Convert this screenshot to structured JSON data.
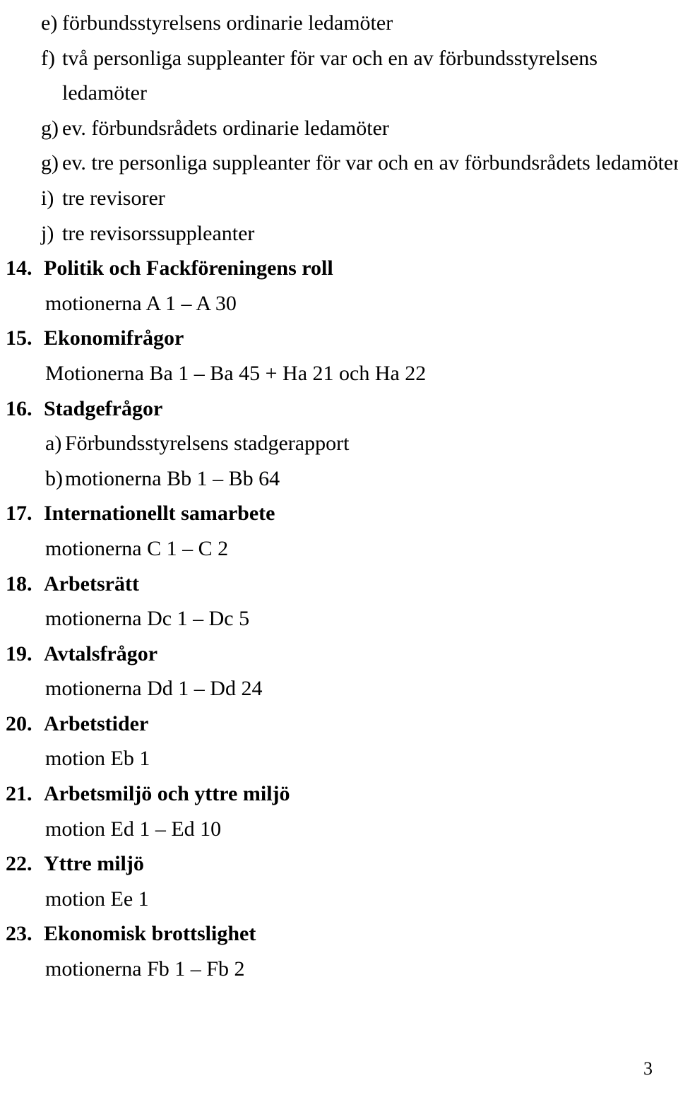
{
  "document": {
    "page_number": "3",
    "lines": [
      {
        "kind": "letter-item",
        "marker": "e)",
        "text": "förbundsstyrelsens ordinarie ledamöter"
      },
      {
        "kind": "letter-item",
        "marker": "f)",
        "text": "två personliga suppleanter för var och en av förbundsstyrelsens"
      },
      {
        "kind": "continuation",
        "marker": "",
        "text": "ledamöter"
      },
      {
        "kind": "letter-item",
        "marker": "g)",
        "text": "ev. förbundsrådets ordinarie ledamöter"
      },
      {
        "kind": "letter-item",
        "marker": "g)",
        "text": "ev. tre personliga suppleanter för var och en av förbundsrådets ledamöter"
      },
      {
        "kind": "letter-item",
        "marker": "i)",
        "text": "tre revisorer"
      },
      {
        "kind": "letter-item",
        "marker": "j)",
        "text": "tre revisorssuppleanter"
      },
      {
        "kind": "num-head",
        "marker": "14.",
        "text": "Politik och Fackföreningens roll"
      },
      {
        "kind": "detail",
        "marker": "",
        "text": "motionerna  A 1 – A 30"
      },
      {
        "kind": "num-head",
        "marker": "15.",
        "text": "Ekonomifrågor"
      },
      {
        "kind": "detail",
        "marker": "",
        "text": "Motionerna Ba 1 – Ba 45 + Ha 21 och Ha 22"
      },
      {
        "kind": "num-head",
        "marker": "16.",
        "text": "Stadgefrågor"
      },
      {
        "kind": "sub-letter",
        "marker": "a)",
        "text": "Förbundsstyrelsens stadgerapport"
      },
      {
        "kind": "sub-letter",
        "marker": "b)",
        "text": "motionerna Bb 1 – Bb 64"
      },
      {
        "kind": "num-head",
        "marker": "17.",
        "text": "Internationellt samarbete"
      },
      {
        "kind": "detail",
        "marker": "",
        "text": "motionerna C 1 – C 2"
      },
      {
        "kind": "num-head",
        "marker": "18.",
        "text": "Arbetsrätt"
      },
      {
        "kind": "detail",
        "marker": "",
        "text": "motionerna Dc 1 – Dc 5"
      },
      {
        "kind": "num-head",
        "marker": "19.",
        "text": "Avtalsfrågor"
      },
      {
        "kind": "detail",
        "marker": "",
        "text": "motionerna Dd 1 – Dd 24"
      },
      {
        "kind": "num-head",
        "marker": "20.",
        "text": "Arbetstider"
      },
      {
        "kind": "detail",
        "marker": "",
        "text": "motion Eb 1"
      },
      {
        "kind": "num-head",
        "marker": "21.",
        "text": "Arbetsmiljö och yttre miljö"
      },
      {
        "kind": "detail",
        "marker": "",
        "text": "motion Ed 1 – Ed 10"
      },
      {
        "kind": "num-head",
        "marker": "22.",
        "text": "Yttre miljö"
      },
      {
        "kind": "detail",
        "marker": "",
        "text": "motion Ee 1"
      },
      {
        "kind": "num-head",
        "marker": "23.",
        "text": "Ekonomisk brottslighet"
      },
      {
        "kind": "detail",
        "marker": "",
        "text": "motionerna Fb 1 – Fb 2"
      }
    ]
  }
}
